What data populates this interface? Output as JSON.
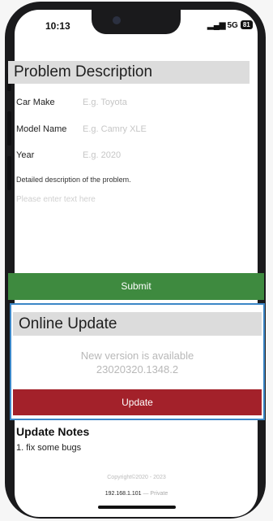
{
  "status_bar": {
    "time": "10:13",
    "network": "5G",
    "battery": "81"
  },
  "problem_description": {
    "title": "Problem Description",
    "fields": [
      {
        "label": "Car Make",
        "placeholder": "E.g. Toyota"
      },
      {
        "label": "Model Name",
        "placeholder": "E.g. Camry XLE"
      },
      {
        "label": "Year",
        "placeholder": "E.g. 2020"
      }
    ],
    "description_label": "Detailed description of the problem.",
    "description_placeholder": "Please enter text here",
    "submit_label": "Submit"
  },
  "online_update": {
    "title": "Online Update",
    "message": "New version is available",
    "version": "23020320.1348.2",
    "update_label": "Update"
  },
  "update_notes": {
    "title": "Update Notes",
    "items": [
      "1. fix some bugs"
    ]
  },
  "footer": {
    "copyright": "Copyright©2020 - 2023",
    "ip": "192.168.1.101",
    "environment": "— Private"
  },
  "colors": {
    "submit_bg": "#3e8a3f",
    "update_bg": "#a3212a",
    "panel_border": "#3b86c7",
    "header_bg": "#dcdcdc"
  }
}
